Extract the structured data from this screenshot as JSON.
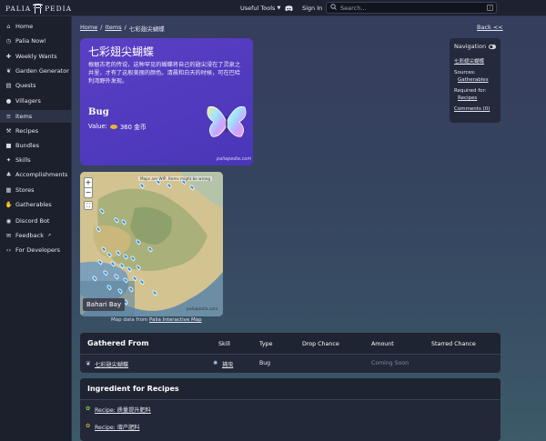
{
  "topbar": {
    "brand": "PALIA PEDIA",
    "useful_tools": "Useful Tools",
    "sign_in": "Sign In",
    "search_placeholder": "Search...",
    "search_shortcut": "/"
  },
  "sidebar": {
    "items": [
      {
        "label": "Home",
        "icon": "home-icon"
      },
      {
        "label": "Palia Now!",
        "icon": "clock-icon"
      },
      {
        "label": "Weekly Wants",
        "icon": "gift-icon"
      },
      {
        "label": "Garden Generator",
        "icon": "seedling-icon"
      },
      {
        "label": "Quests",
        "icon": "map-icon"
      },
      {
        "label": "Villagers",
        "icon": "people-icon"
      },
      {
        "label": "Items",
        "icon": "list-icon"
      },
      {
        "label": "Recipes",
        "icon": "hammer-icon"
      },
      {
        "label": "Bundles",
        "icon": "box-icon"
      },
      {
        "label": "Skills",
        "icon": "star-icon"
      },
      {
        "label": "Accomplishments",
        "icon": "trophy-icon"
      },
      {
        "label": "Stores",
        "icon": "store-icon"
      },
      {
        "label": "Gatherables",
        "icon": "hand-icon"
      },
      {
        "label": "Discord Bot",
        "icon": "robot-icon"
      },
      {
        "label": "Feedback",
        "icon": "chat-icon"
      },
      {
        "label": "For Developers",
        "icon": "code-icon"
      }
    ],
    "active": "Items"
  },
  "breadcrumb": {
    "home": "Home",
    "items": "Items",
    "current": "七彩翅尖蝴蝶",
    "sep": "/"
  },
  "back": "Back <<",
  "item": {
    "name": "七彩翅尖蝴蝶",
    "description": "根据古老的传说，这种罕见的蝴蝶将自己的翅尖浸在了灵泉之井里，才有了这般美丽的颜色。清晨和白天的时候，可在巴哈利湾野外发现。",
    "type": "Bug",
    "value_label": "Value:",
    "value": "360 金币",
    "site": "paliapedia.com"
  },
  "navigation": {
    "title": "Navigation",
    "item_link": "七彩翅尖蝴蝶",
    "sources_label": "Sources:",
    "sources": "Gatherables",
    "required_label": "Required for:",
    "required": "Recipes",
    "comments": "Comments (0)"
  },
  "map": {
    "zoom_in": "+",
    "zoom_out": "−",
    "fullscreen": "⛶",
    "label": "Bahari Bay",
    "warning": "Maps are WIP, Items might be wrong",
    "site": "paliapedia.com",
    "note_prefix": "Map data from",
    "note_link": "Palia Interactive Map"
  },
  "gathered": {
    "title": "Gathered From",
    "columns": [
      "Skill",
      "Type",
      "Drop Chance",
      "Amount",
      "Starred Chance"
    ],
    "rows": [
      {
        "name": "七彩翅尖蝴蝶",
        "skill": "捕虫",
        "type": "Bug",
        "drop": "",
        "amount": "Coming Soon",
        "starred": ""
      }
    ]
  },
  "ingredient": {
    "title": "Ingredient for Recipes",
    "rows": [
      "Recipe: 质量提升肥料",
      "Recipe: 增产肥料"
    ]
  },
  "colors": {
    "card": "#5a3fc4",
    "sidebar": "#1c1f2c",
    "pin": "#2a8fd6"
  }
}
